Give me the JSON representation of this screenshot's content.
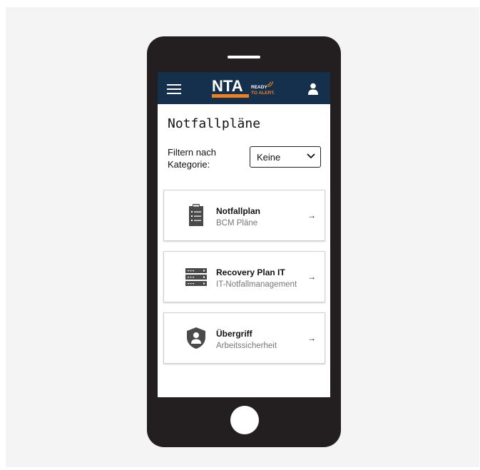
{
  "header": {
    "logo_text": "NTA",
    "logo_tag_line1": "READY",
    "logo_tag_line2": "TO ALERT."
  },
  "page": {
    "title": "Notfallpläne"
  },
  "filter": {
    "label": "Filtern nach Kategorie:",
    "selected": "Keine"
  },
  "cards": [
    {
      "title": "Notfallplan",
      "subtitle": "BCM Pläne",
      "icon": "clipboard-list-icon",
      "arrow": "→"
    },
    {
      "title": "Recovery Plan IT",
      "subtitle": "IT-Notfallmanagement",
      "icon": "server-rack-icon",
      "arrow": "→"
    },
    {
      "title": "Übergriff",
      "subtitle": "Arbeitssicherheit",
      "icon": "shield-person-icon",
      "arrow": "→"
    }
  ],
  "colors": {
    "appbar": "#15304d",
    "brand_orange": "#f07f1e",
    "phone_body": "#231f20",
    "icon_gray": "#4a4a4a"
  }
}
